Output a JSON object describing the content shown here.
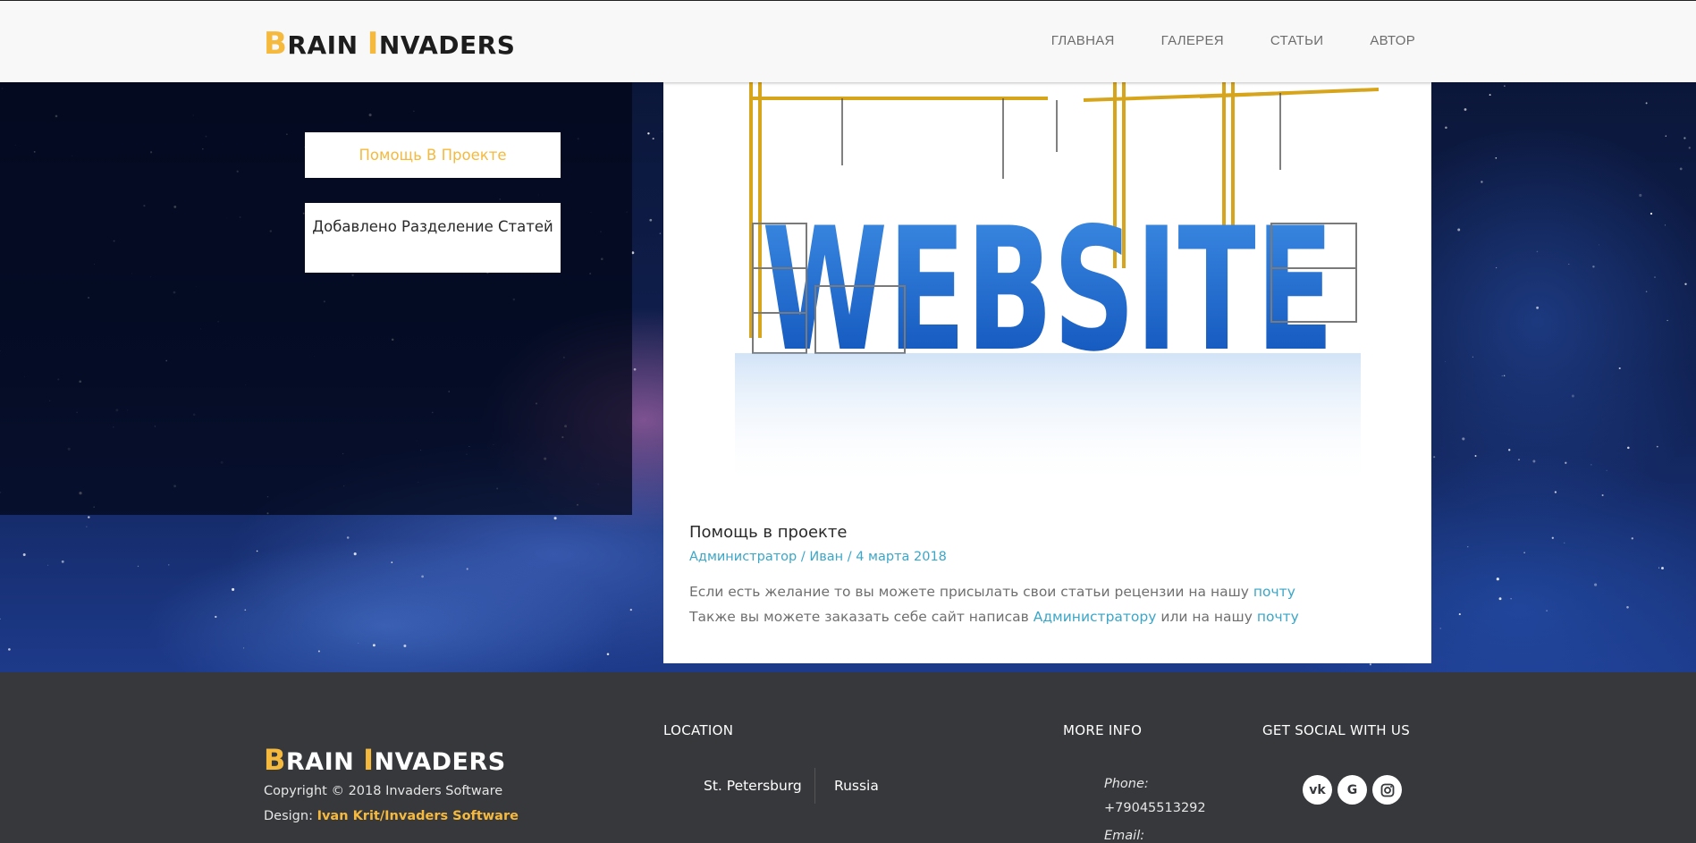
{
  "header": {
    "logo": {
      "cap1": "B",
      "rest1": "RAIN ",
      "cap2": "I",
      "rest2": "NVADERS"
    },
    "nav": [
      "ГЛАВНАЯ",
      "ГАЛЕРЕЯ",
      "СТАТЬИ",
      "АВТОР"
    ]
  },
  "sidebar": {
    "buttons": [
      "Помощь В Проекте",
      "Добавлено Разделение Статей"
    ]
  },
  "article": {
    "image_alt": "WEBSITE",
    "title": "Помощь в проекте",
    "meta": "Администратор / Иван / 4 марта 2018",
    "line1_text": "Если есть желание то вы можете присылать свои статьи рецензии на нашу ",
    "line1_link": "почту",
    "line2_text": "Также вы можете заказать себе сайт написав ",
    "line2_link1": "Администратору",
    "line2_mid": " или на нашу ",
    "line2_link2": "почту"
  },
  "footer": {
    "logo": {
      "cap1": "B",
      "rest1": "RAIN ",
      "cap2": "I",
      "rest2": "NVADERS"
    },
    "copyright": "Copyright © 2018 Invaders Software",
    "design_label": "Design: ",
    "design_author": "Ivan Krit/Invaders Software",
    "location_heading": "LOCATION",
    "city": "St. Petersburg",
    "country": "Russia",
    "more_info_heading": "MORE INFO",
    "phone_label": "Phone:",
    "phone": "+79045513292",
    "email_label": "Email:",
    "social_heading": "GET SOCIAL WITH US",
    "social_icons": [
      "vk-icon",
      "google-icon",
      "instagram-icon"
    ]
  },
  "colors": {
    "accent": "#f5b93d",
    "link": "#3aa6c8",
    "footer_bg": "#36383b",
    "header_bg": "#f8f8f8"
  }
}
